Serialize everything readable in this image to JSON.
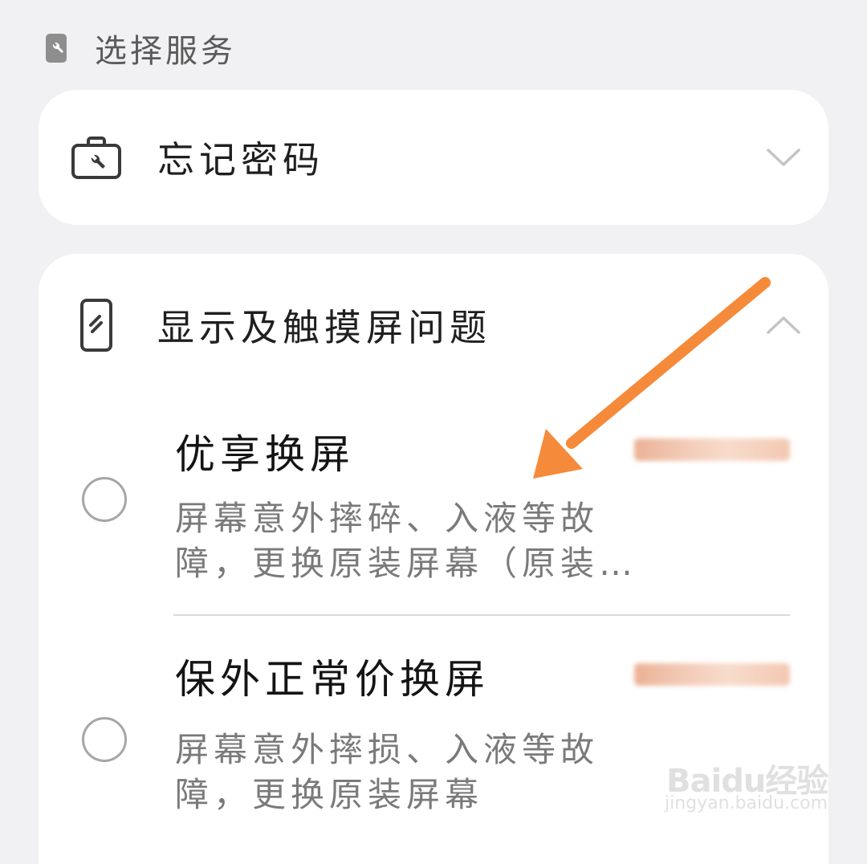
{
  "section": {
    "title": "选择服务",
    "icon": "wrench-badge-icon"
  },
  "services": [
    {
      "title": "忘记密码",
      "icon": "toolbox-icon",
      "expanded": false,
      "chevron": "chevron-down-icon"
    },
    {
      "title": "显示及触摸屏问题",
      "icon": "phone-screen-icon",
      "expanded": true,
      "chevron": "chevron-up-icon"
    }
  ],
  "options": [
    {
      "title": "优享换屏",
      "desc_lines": [
        "屏幕意外摔碎、入液等故",
        "障，更换原装屏幕（原装…"
      ],
      "selected": false,
      "price": "blurred"
    },
    {
      "title": "保外正常价换屏",
      "desc_lines": [
        "屏幕意外摔损、入液等故",
        "障，更换原装屏幕"
      ],
      "selected": false,
      "price": "blurred"
    }
  ],
  "annotation": {
    "arrow_color": "#f58a3a"
  },
  "watermark": {
    "logo": "Baidu经验",
    "url": "jingyan.baidu.com"
  }
}
